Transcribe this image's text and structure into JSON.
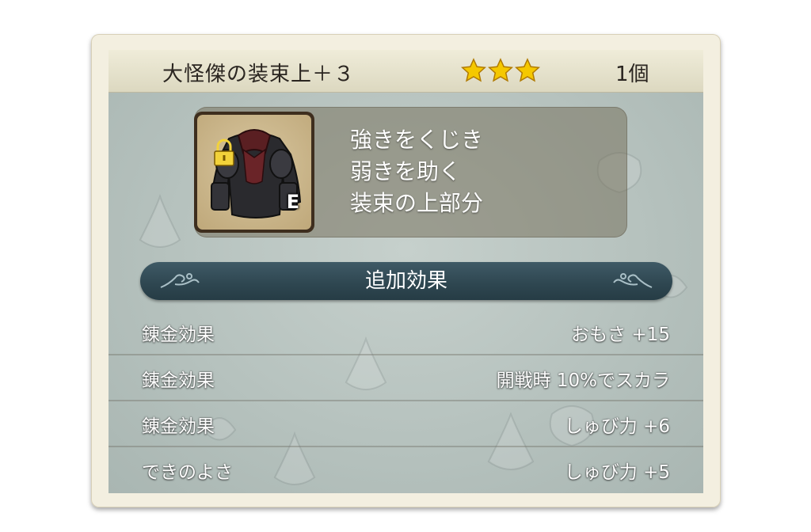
{
  "item": {
    "name": "大怪傑の装束上＋３",
    "rarity_stars": 3,
    "count": "1個",
    "icon": "armor-top-icon",
    "equipped_badge": "E",
    "locked": true,
    "description": [
      "強きをくじき",
      "弱きを助く",
      "装束の上部分"
    ]
  },
  "effects": {
    "section_title": "追加効果",
    "rows": [
      {
        "label": "錬金効果",
        "value": "おもさ +15"
      },
      {
        "label": "錬金効果",
        "value": "開戦時 10%でスカラ"
      },
      {
        "label": "錬金効果",
        "value": "しゅび力 +6"
      },
      {
        "label": "できのよさ",
        "value": "しゅび力 +5"
      }
    ]
  },
  "colors": {
    "star": "#f5c800",
    "effect_bar": "#2e4650",
    "panel": "#b6c2be"
  }
}
